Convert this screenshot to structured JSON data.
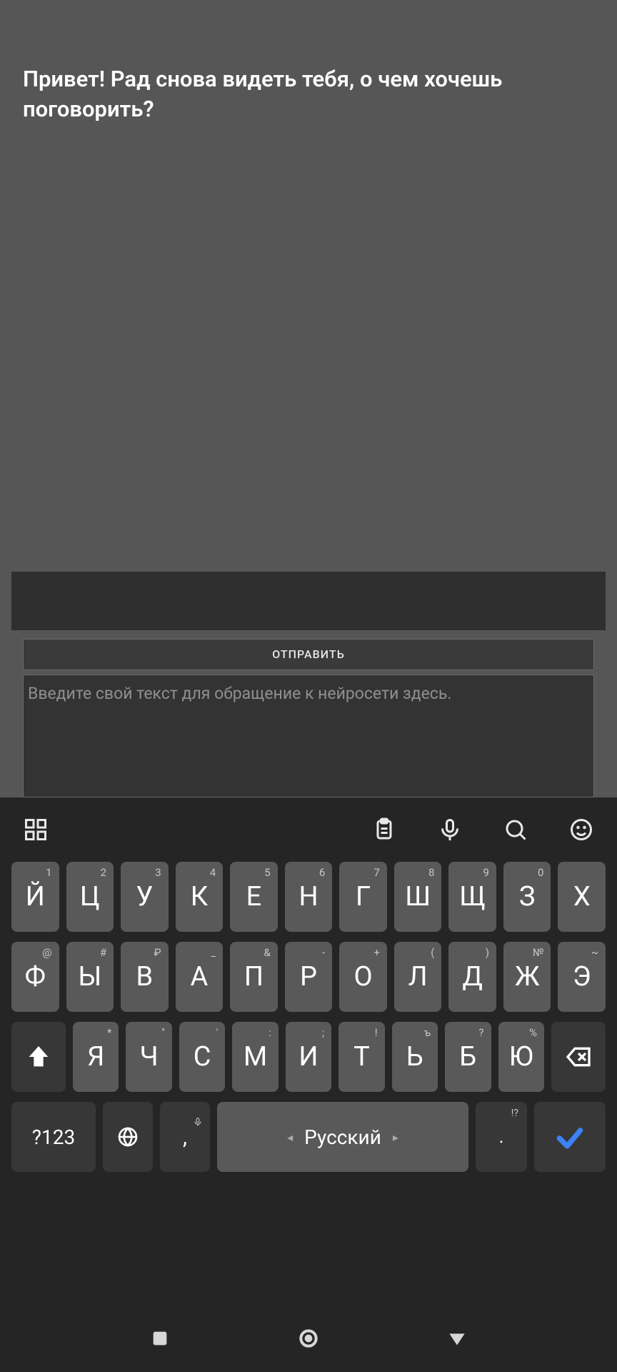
{
  "chat": {
    "greeting": "Привет! Рад снова видеть тебя, о чем хочешь поговорить?"
  },
  "input_panel": {
    "send_label": "ОТПРАВИТЬ",
    "placeholder": "Введите свой текст для обращение к нейросети здесь."
  },
  "keyboard": {
    "toolbar_icons": [
      "grid-icon",
      "clipboard-icon",
      "mic-icon",
      "search-icon",
      "emoji-icon"
    ],
    "row1": [
      {
        "main": "Й",
        "super": "1"
      },
      {
        "main": "Ц",
        "super": "2"
      },
      {
        "main": "У",
        "super": "3"
      },
      {
        "main": "К",
        "super": "4"
      },
      {
        "main": "Е",
        "super": "5"
      },
      {
        "main": "Н",
        "super": "6"
      },
      {
        "main": "Г",
        "super": "7"
      },
      {
        "main": "Ш",
        "super": "8"
      },
      {
        "main": "Щ",
        "super": "9"
      },
      {
        "main": "З",
        "super": "0"
      },
      {
        "main": "Х",
        "super": ""
      }
    ],
    "row2": [
      {
        "main": "Ф",
        "super": "@"
      },
      {
        "main": "Ы",
        "super": "#"
      },
      {
        "main": "В",
        "super": "₽"
      },
      {
        "main": "А",
        "super": "_"
      },
      {
        "main": "П",
        "super": "&"
      },
      {
        "main": "Р",
        "super": "-"
      },
      {
        "main": "О",
        "super": "+"
      },
      {
        "main": "Л",
        "super": "("
      },
      {
        "main": "Д",
        "super": ")"
      },
      {
        "main": "Ж",
        "super": "№"
      },
      {
        "main": "Э",
        "super": "~"
      }
    ],
    "row3": [
      {
        "main": "Я",
        "super": "*"
      },
      {
        "main": "Ч",
        "super": "''"
      },
      {
        "main": "С",
        "super": "'"
      },
      {
        "main": "М",
        "super": ":"
      },
      {
        "main": "И",
        "super": ";"
      },
      {
        "main": "Т",
        "super": "!"
      },
      {
        "main": "Ь",
        "super": "ъ"
      },
      {
        "main": "Б",
        "super": "?"
      },
      {
        "main": "Ю",
        "super": "%"
      }
    ],
    "numeric_label": "?123",
    "comma": ",",
    "space_label": "Русский",
    "dot": ".",
    "dot_super": "!?"
  }
}
